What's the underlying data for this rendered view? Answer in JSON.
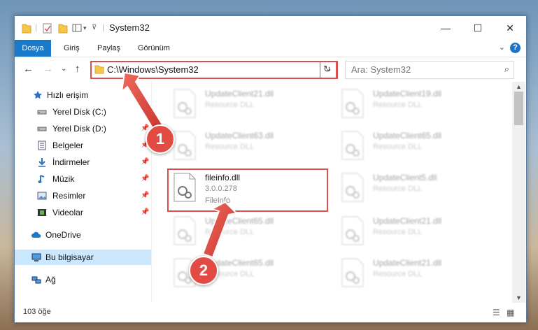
{
  "window": {
    "title": "System32",
    "controls": {
      "minimize": "—",
      "maximize": "☐",
      "close": "✕"
    }
  },
  "ribbon": {
    "tabs": [
      "Dosya",
      "Giriş",
      "Paylaş",
      "Görünüm"
    ],
    "help": "?"
  },
  "address": {
    "path": "C:\\Windows\\System32",
    "search_placeholder": "Ara: System32"
  },
  "nav": {
    "items": [
      {
        "label": "Hızlı erişim",
        "icon": "star-icon",
        "pinned": false
      },
      {
        "label": "Yerel Disk (C:)",
        "icon": "drive-icon",
        "pinned": false
      },
      {
        "label": "Yerel Disk (D:)",
        "icon": "drive-icon",
        "pinned": true
      },
      {
        "label": "Belgeler",
        "icon": "documents-icon",
        "pinned": true
      },
      {
        "label": "İndirmeler",
        "icon": "download-icon",
        "pinned": true
      },
      {
        "label": "Müzik",
        "icon": "music-icon",
        "pinned": true
      },
      {
        "label": "Resimler",
        "icon": "pictures-icon",
        "pinned": true
      },
      {
        "label": "Videolar",
        "icon": "videos-icon",
        "pinned": true
      },
      {
        "label": "OneDrive",
        "icon": "cloud-icon",
        "pinned": false
      },
      {
        "label": "Bu bilgisayar",
        "icon": "computer-icon",
        "pinned": false
      },
      {
        "label": "Ağ",
        "icon": "network-icon",
        "pinned": false
      }
    ]
  },
  "files": {
    "left": [
      {
        "name": "UpdateClient21.dll",
        "desc": "Resource DLL"
      },
      {
        "name": "UpdateClient63.dll",
        "desc": "Resource DLL"
      },
      {
        "name": "fileinfo.dll",
        "desc": "3.0.0.278",
        "extra": "FileInfo"
      },
      {
        "name": "UpdateClient65.dll",
        "desc": "Resource DLL"
      },
      {
        "name": "UpdateClient65.dll",
        "desc": "Resource DLL"
      }
    ],
    "right": [
      {
        "name": "UpdateClient19.dll",
        "desc": "Resource DLL"
      },
      {
        "name": "UpdateClient65.dll",
        "desc": "Resource DLL"
      },
      {
        "name": "UpdateClient5.dll",
        "desc": "Resource DLL"
      },
      {
        "name": "UpdateClient21.dll",
        "desc": "Resource DLL"
      },
      {
        "name": "UpdateClient21.dll",
        "desc": "Resource DLL"
      }
    ]
  },
  "status": {
    "count": "103 öğe"
  },
  "annotations": {
    "badge1": "1",
    "badge2": "2"
  },
  "colors": {
    "accent": "#1979ca",
    "highlight": "#d9504e",
    "selected": "#cce8ff"
  }
}
